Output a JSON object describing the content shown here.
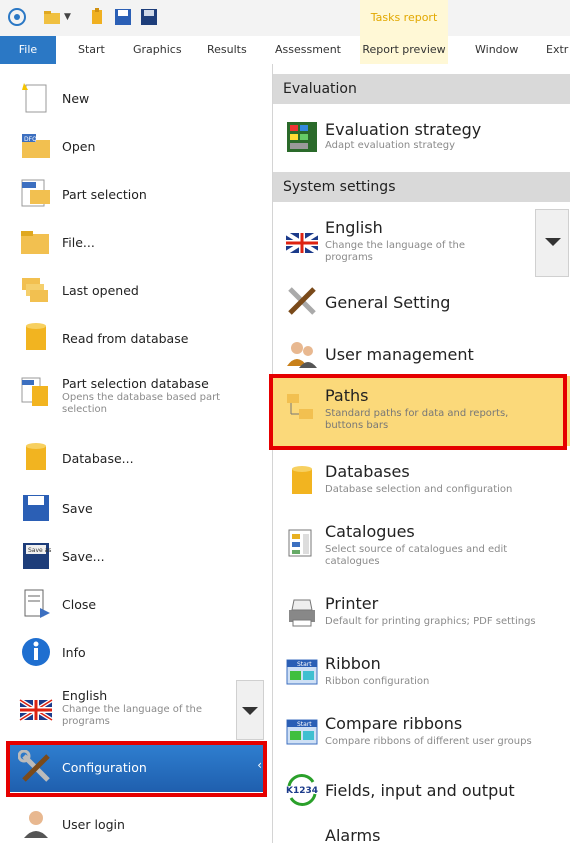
{
  "qat": {
    "tasks_tab": "Tasks report"
  },
  "tabs": [
    "File",
    "Start",
    "Graphics",
    "Results",
    "Assessment",
    "Report preview",
    "Window",
    "Extr"
  ],
  "left_menu": [
    {
      "label": "New",
      "desc": ""
    },
    {
      "label": "Open",
      "desc": ""
    },
    {
      "label": "Part selection",
      "desc": ""
    },
    {
      "label": "File...",
      "desc": ""
    },
    {
      "label": "Last opened",
      "desc": ""
    },
    {
      "label": "Read from database",
      "desc": ""
    },
    {
      "label": "Part selection database",
      "desc": "Opens the database based part selection"
    },
    {
      "label": "Database...",
      "desc": ""
    },
    {
      "label": "Save",
      "desc": ""
    },
    {
      "label": "Save...",
      "desc": ""
    },
    {
      "label": "Close",
      "desc": ""
    },
    {
      "label": "Info",
      "desc": ""
    },
    {
      "label": "English",
      "desc": "Change the language of the programs"
    },
    {
      "label": "Configuration",
      "desc": ""
    },
    {
      "label": "User login",
      "desc": ""
    }
  ],
  "right": {
    "sections": [
      "Evaluation",
      "System settings"
    ],
    "items": [
      {
        "label": "Evaluation strategy",
        "desc": "Adapt evaluation strategy"
      },
      {
        "label": "English",
        "desc": "Change the language of the programs"
      },
      {
        "label": "General Setting",
        "desc": ""
      },
      {
        "label": "User management",
        "desc": ""
      },
      {
        "label": "Paths",
        "desc": "Standard paths for data and reports, buttons bars"
      },
      {
        "label": "Databases",
        "desc": "Database selection and configuration"
      },
      {
        "label": "Catalogues",
        "desc": "Select source of catalogues and edit catalogues"
      },
      {
        "label": "Printer",
        "desc": "Default for printing graphics; PDF settings"
      },
      {
        "label": "Ribbon",
        "desc": "Ribbon configuration"
      },
      {
        "label": "Compare ribbons",
        "desc": "Compare ribbons of different user groups"
      },
      {
        "label": "Fields, input and output",
        "desc": ""
      },
      {
        "label": "Alarms",
        "desc": ""
      }
    ]
  },
  "icons": {
    "start_badge": "Start",
    "dfq_badge": "DFQ",
    "save_badge": "Save as",
    "k1234_badge": "K1234"
  },
  "colors": {
    "file_tab": "#2b78c5",
    "highlight": "#fbd97a",
    "selection": "#2f7fd0",
    "red_box": "#e50000"
  }
}
